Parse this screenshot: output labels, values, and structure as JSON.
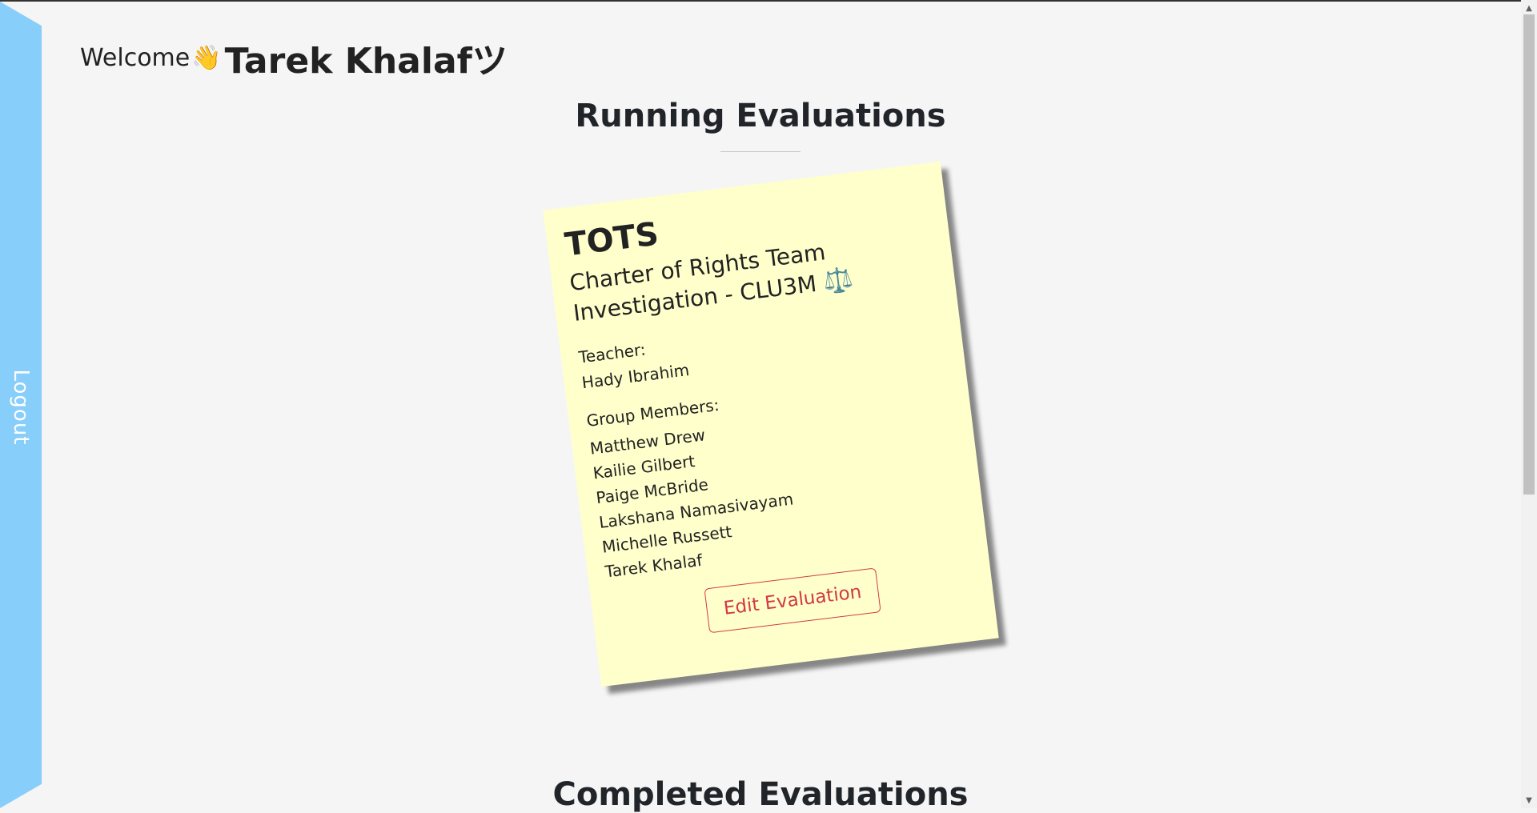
{
  "sidebar": {
    "logout_label": "Logout"
  },
  "header": {
    "welcome_text": "Welcome",
    "wave_emoji": "👋",
    "user_name": "Tarek Khalafツ"
  },
  "sections": {
    "running_title": "Running Evaluations",
    "completed_title": "Completed Evaluations"
  },
  "evaluation_card": {
    "title": "TOTS",
    "subtitle": "Charter of Rights Team Investigation - CLU3M",
    "subtitle_icon": "⚖️",
    "teacher_label": "Teacher:",
    "teacher_name": "Hady Ibrahim",
    "members_label": "Group Members:",
    "members": [
      "Matthew Drew",
      "Kailie Gilbert",
      "Paige McBride",
      "Lakshana Namasivayam",
      "Michelle Russett",
      "Tarek Khalaf"
    ],
    "edit_button_label": "Edit Evaluation"
  },
  "colors": {
    "sidebar": "#87cefa",
    "card": "#ffffcc",
    "edit_button": "#d23a46",
    "background": "#f5f5f5"
  },
  "scrollbar": {
    "up_arrow": "▲",
    "down_arrow": "▼"
  }
}
